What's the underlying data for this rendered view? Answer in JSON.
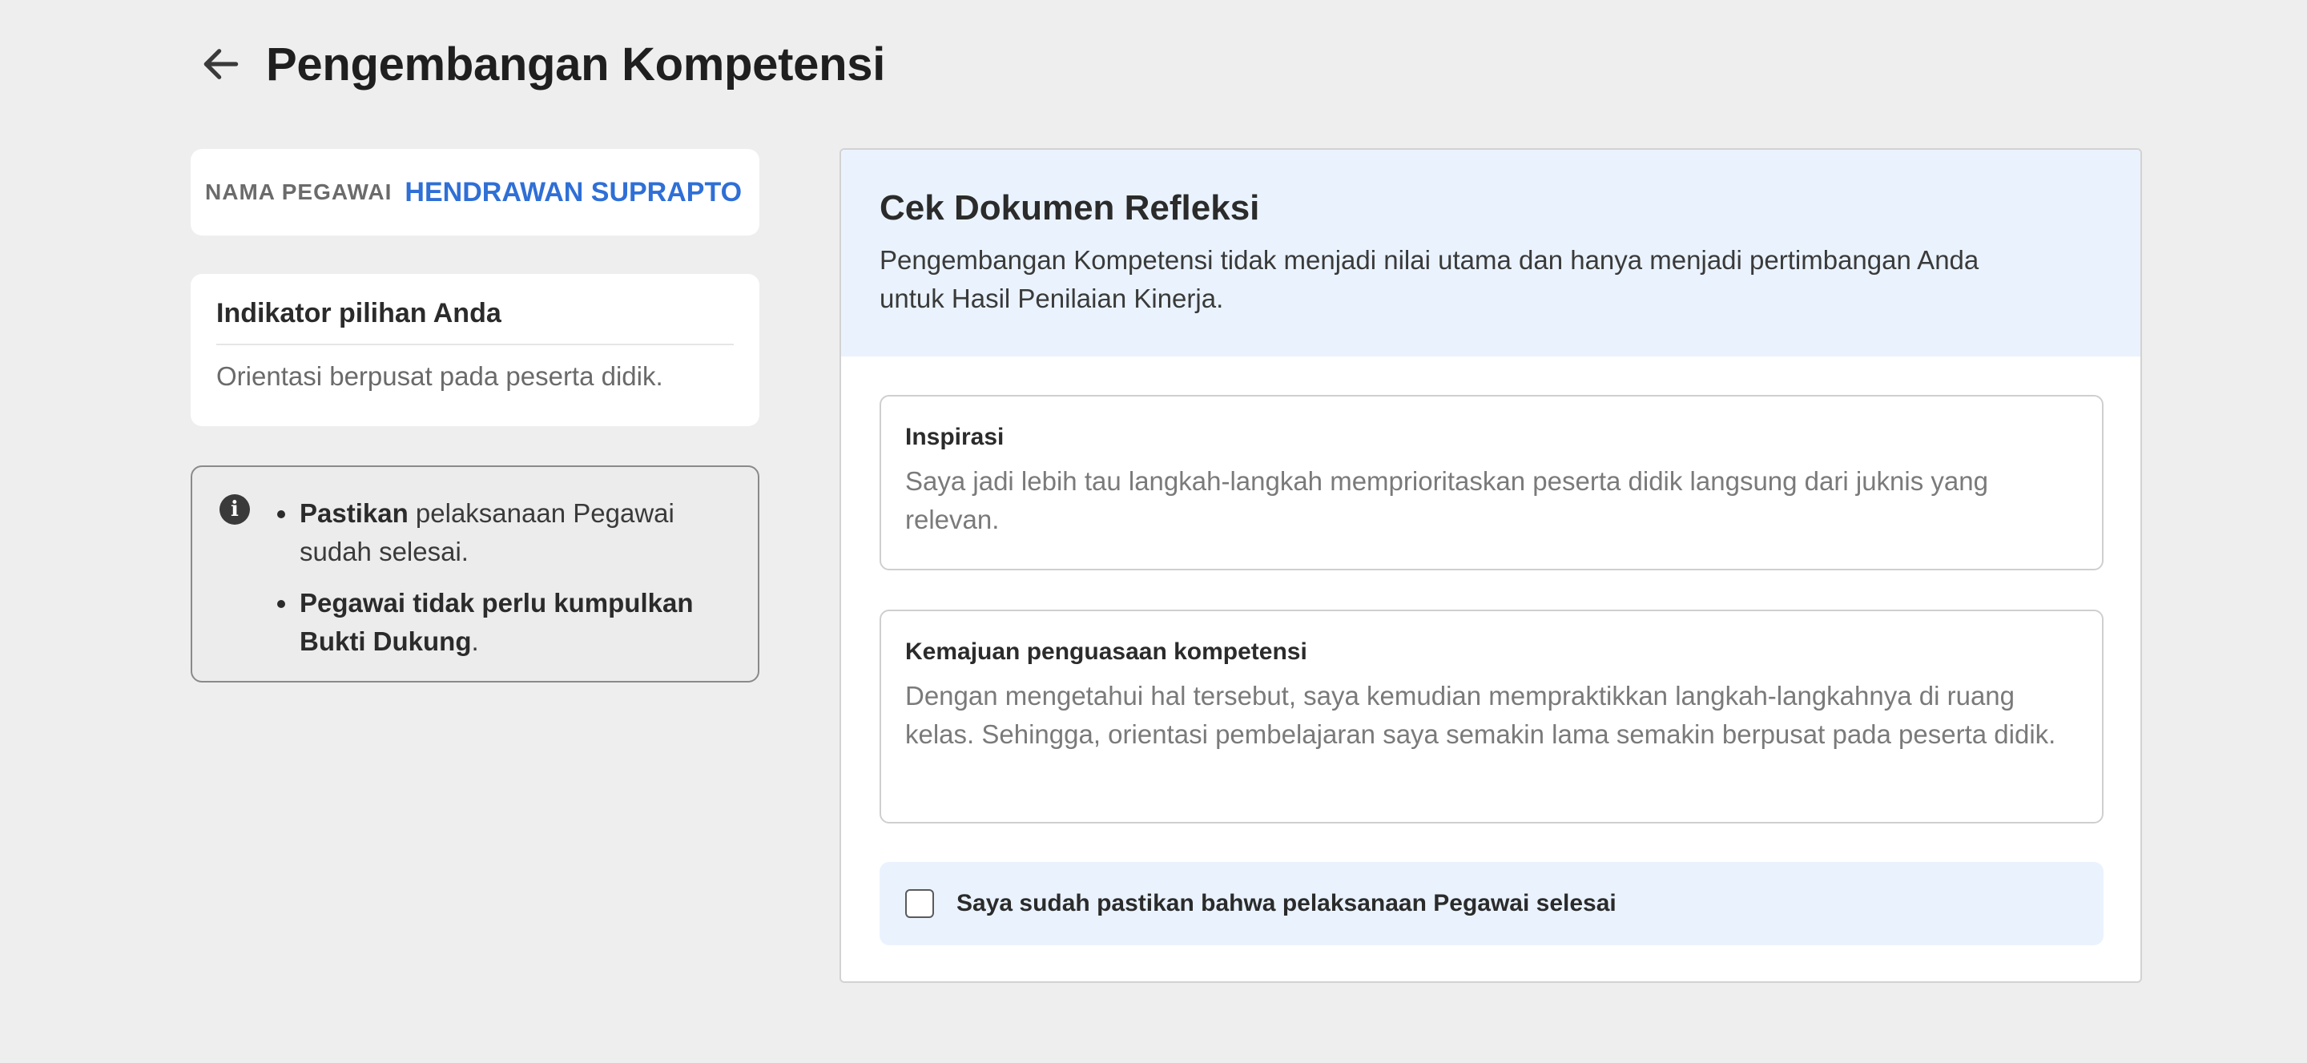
{
  "header": {
    "back_icon": "arrow-left-icon",
    "title": "Pengembangan Kompetensi"
  },
  "employee": {
    "label": "NAMA PEGAWAI",
    "name": "HENDRAWAN SUPRAPTO"
  },
  "indicator": {
    "title": "Indikator pilihan Anda",
    "text": "Orientasi berpusat pada peserta didik."
  },
  "info": {
    "icon": "info-icon",
    "items": [
      {
        "bold": "Pastikan",
        "text": " pelaksanaan Pegawai sudah selesai."
      },
      {
        "bold": "Pegawai tidak perlu kumpulkan Bukti Dukung",
        "text": "."
      }
    ]
  },
  "panel": {
    "title": "Cek Dokumen Refleksi",
    "description": "Pengembangan Kompetensi tidak menjadi nilai utama dan hanya menjadi pertimbangan Anda untuk Hasil Penilaian Kinerja.",
    "sections": [
      {
        "title": "Inspirasi",
        "text": "Saya jadi lebih tau langkah-langkah memprioritaskan peserta didik langsung dari juknis yang relevan."
      },
      {
        "title": "Kemajuan penguasaan kompetensi",
        "text": "Dengan mengetahui hal tersebut, saya kemudian mempraktikkan langkah-langkahnya di ruang kelas. Sehingga, orientasi pembelajaran saya semakin lama semakin berpusat pada peserta didik."
      }
    ],
    "confirm_label": "Saya sudah pastikan bahwa pelaksanaan Pegawai selesai",
    "confirm_checked": false
  },
  "colors": {
    "accent": "#2f6fd6",
    "panel_head_bg": "#eaf3fd",
    "page_bg": "#eeeeee"
  }
}
